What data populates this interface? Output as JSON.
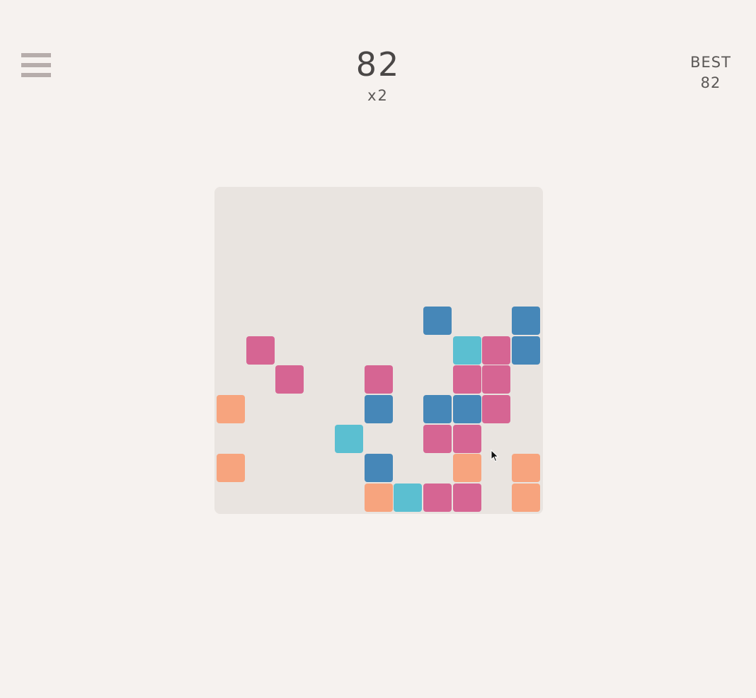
{
  "header": {
    "menu_icon": "hamburger-menu-icon",
    "score": "82",
    "multiplier": "x2",
    "best_label": "BEST",
    "best_value": "82"
  },
  "colors": {
    "background": "#f6f2ef",
    "board": "#e9e4e0",
    "pink": "#d66593",
    "blue": "#4687b8",
    "cyan": "#5bbfd1",
    "orange": "#f7a47e"
  },
  "board": {
    "tiles": [
      {
        "color": "blue",
        "row": 4,
        "col": 7
      },
      {
        "color": "blue",
        "row": 4,
        "col": 10
      },
      {
        "color": "pink",
        "row": 5,
        "col": 1
      },
      {
        "color": "cyan",
        "row": 5,
        "col": 8
      },
      {
        "color": "pink",
        "row": 5,
        "col": 9
      },
      {
        "color": "blue",
        "row": 5,
        "col": 10
      },
      {
        "color": "pink",
        "row": 6,
        "col": 2
      },
      {
        "color": "pink",
        "row": 6,
        "col": 5
      },
      {
        "color": "pink",
        "row": 6,
        "col": 8
      },
      {
        "color": "pink",
        "row": 6,
        "col": 9
      },
      {
        "color": "orange",
        "row": 7,
        "col": 0
      },
      {
        "color": "blue",
        "row": 7,
        "col": 5
      },
      {
        "color": "blue",
        "row": 7,
        "col": 7
      },
      {
        "color": "blue",
        "row": 7,
        "col": 8
      },
      {
        "color": "pink",
        "row": 7,
        "col": 9
      },
      {
        "color": "cyan",
        "row": 8,
        "col": 4
      },
      {
        "color": "pink",
        "row": 8,
        "col": 7
      },
      {
        "color": "pink",
        "row": 8,
        "col": 8
      },
      {
        "color": "orange",
        "row": 9,
        "col": 0
      },
      {
        "color": "blue",
        "row": 9,
        "col": 5
      },
      {
        "color": "orange",
        "row": 9,
        "col": 8
      },
      {
        "color": "orange",
        "row": 9,
        "col": 10
      },
      {
        "color": "orange",
        "row": 10,
        "col": 5
      },
      {
        "color": "cyan",
        "row": 10,
        "col": 6
      },
      {
        "color": "pink",
        "row": 10,
        "col": 7
      },
      {
        "color": "pink",
        "row": 10,
        "col": 8
      },
      {
        "color": "orange",
        "row": 10,
        "col": 10
      }
    ]
  }
}
